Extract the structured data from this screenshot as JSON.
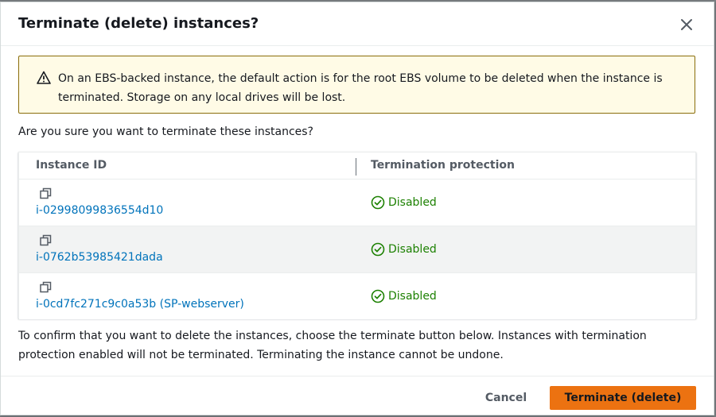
{
  "dialog": {
    "title": "Terminate (delete) instances?",
    "close_icon": "close-icon",
    "warning": {
      "icon": "warning-icon",
      "text": "On an EBS-backed instance, the default action is for the root EBS volume to be deleted when the instance is terminated. Storage on any local drives will be lost."
    },
    "question": "Are you sure you want to terminate these instances?",
    "table": {
      "columns": [
        "Instance ID",
        "Termination protection"
      ],
      "rows": [
        {
          "copy_icon": "copy-icon",
          "instance_id": "i-02998099836554d10",
          "status_icon": "check-circle-icon",
          "protection": "Disabled"
        },
        {
          "copy_icon": "copy-icon",
          "instance_id": "i-0762b53985421dada",
          "status_icon": "check-circle-icon",
          "protection": "Disabled"
        },
        {
          "copy_icon": "copy-icon",
          "instance_id": "i-0cd7fc271c9c0a53b (SP-webserver)",
          "status_icon": "check-circle-icon",
          "protection": "Disabled"
        }
      ]
    },
    "confirm_text": "To confirm that you want to delete the instances, choose the terminate button below. Instances with termination protection enabled will not be terminated. Terminating the instance cannot be undone.",
    "footer": {
      "cancel_label": "Cancel",
      "terminate_label": "Terminate (delete)"
    }
  },
  "colors": {
    "primary_button": "#ec7211",
    "link": "#0073bb",
    "success": "#1d8102",
    "warning_bg": "#fffbe6",
    "warning_border": "#8a6d0b"
  }
}
